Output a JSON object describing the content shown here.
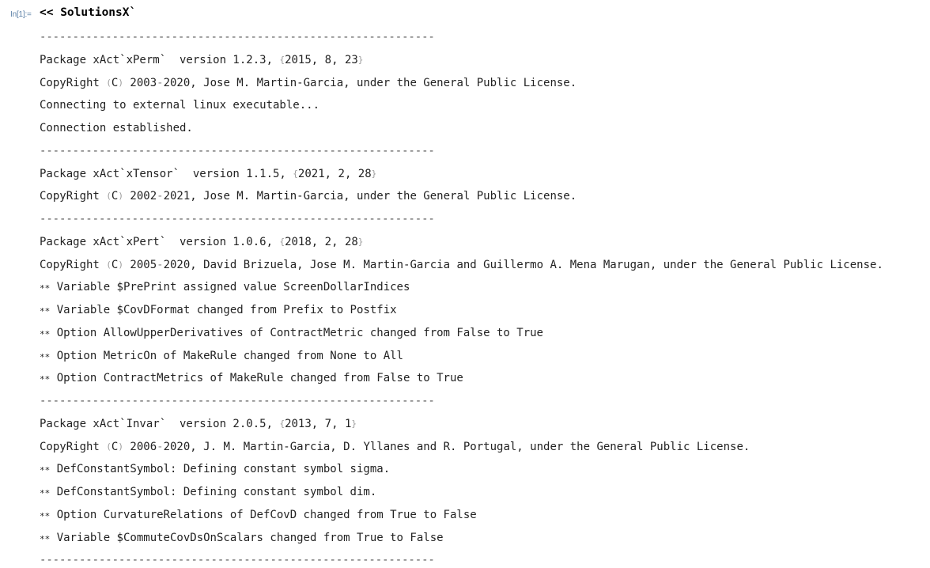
{
  "cell": {
    "label": "In[1]:=",
    "input": "<< SolutionsX`"
  },
  "output_lines": [
    {
      "kind": "sep",
      "text": "------------------------------------------------------------"
    },
    {
      "kind": "package",
      "prefix": "Package xAct`xPerm`  version 1.2.3, ",
      "date": [
        "2015",
        "8",
        "23"
      ]
    },
    {
      "kind": "copyright",
      "years": [
        "2003",
        "2020"
      ],
      "rest": ", Jose M. Martin-Garcia, under the General Public License."
    },
    {
      "kind": "text",
      "text": "Connecting to external linux executable..."
    },
    {
      "kind": "text",
      "text": "Connection established."
    },
    {
      "kind": "sep",
      "text": "------------------------------------------------------------"
    },
    {
      "kind": "package",
      "prefix": "Package xAct`xTensor`  version 1.1.5, ",
      "date": [
        "2021",
        "2",
        "28"
      ]
    },
    {
      "kind": "copyright",
      "years": [
        "2002",
        "2021"
      ],
      "rest": ", Jose M. Martin-Garcia, under the General Public License."
    },
    {
      "kind": "sep",
      "text": "------------------------------------------------------------"
    },
    {
      "kind": "package",
      "prefix": "Package xAct`xPert`  version 1.0.6, ",
      "date": [
        "2018",
        "2",
        "28"
      ]
    },
    {
      "kind": "copyright",
      "years": [
        "2005",
        "2020"
      ],
      "rest": ", David Brizuela, Jose M. Martin-Garcia and Guillermo A. Mena Marugan, under the General Public License."
    },
    {
      "kind": "star",
      "text": "Variable $PrePrint assigned value ScreenDollarIndices"
    },
    {
      "kind": "star",
      "text": "Variable $CovDFormat changed from Prefix to Postfix"
    },
    {
      "kind": "star",
      "text": "Option AllowUpperDerivatives of ContractMetric changed from False to True"
    },
    {
      "kind": "star",
      "text": "Option MetricOn of MakeRule changed from None to All"
    },
    {
      "kind": "star",
      "text": "Option ContractMetrics of MakeRule changed from False to True"
    },
    {
      "kind": "sep",
      "text": "------------------------------------------------------------"
    },
    {
      "kind": "package",
      "prefix": "Package xAct`Invar`  version 2.0.5, ",
      "date": [
        "2013",
        "7",
        "1"
      ]
    },
    {
      "kind": "copyright",
      "years": [
        "2006",
        "2020"
      ],
      "rest": ", J. M. Martin-Garcia, D. Yllanes and R. Portugal, under the General Public License."
    },
    {
      "kind": "star",
      "text": "DefConstantSymbol: Defining constant symbol sigma."
    },
    {
      "kind": "star",
      "text": "DefConstantSymbol: Defining constant symbol dim."
    },
    {
      "kind": "star",
      "text": "Option CurvatureRelations of DefCovD changed from True to False"
    },
    {
      "kind": "star",
      "text": "Variable $CommuteCovDsOnScalars changed from True to False"
    },
    {
      "kind": "sep",
      "text": "------------------------------------------------------------"
    }
  ],
  "strings": {
    "copyright_word": "CopyRight",
    "copyright_symbol": "C",
    "star_marker": "**"
  }
}
